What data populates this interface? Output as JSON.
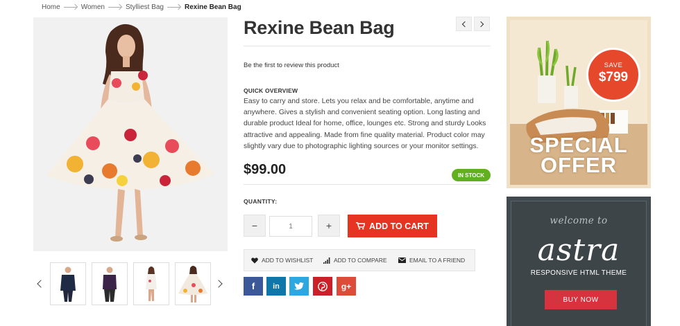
{
  "breadcrumb": {
    "items": [
      "Home",
      "Women",
      "Stylliest Bag"
    ],
    "current": "Rexine Bean Bag"
  },
  "product": {
    "title": "Rexine Bean Bag",
    "review_link": "Be the first to review this product",
    "overview_heading": "QUICK OVERVIEW",
    "overview_text": "Easy to carry and store. Lets you relax and be comfortable, anytime and anywhere. Gives a stylish and convenient seating option. Long lasting and durable product Ideal for home, office, lounges etc. Strong and sturdy Looks attractive and appealing. Made from fine quality material. Product color may slightly vary due to photographic lighting sources or your monitor settings.",
    "price": "$99.00",
    "stock_badge": "IN STOCK",
    "quantity_label": "QUANTITY:",
    "quantity_value": "1",
    "quantity_minus": "−",
    "quantity_plus": "+",
    "add_to_cart": "ADD TO CART"
  },
  "actions": {
    "wishlist": "ADD TO WISHLIST",
    "compare": "ADD TO COMPARE",
    "email": "EMAIL TO A FRIEND"
  },
  "social": [
    {
      "name": "facebook",
      "glyph": "f",
      "color": "#3b5998"
    },
    {
      "name": "linkedin",
      "glyph": "in",
      "color": "#0e76a8"
    },
    {
      "name": "twitter",
      "glyph": "t",
      "color": "#2da7e0"
    },
    {
      "name": "pinterest",
      "glyph": "P",
      "color": "#cb2027"
    },
    {
      "name": "google-plus",
      "glyph": "g+",
      "color": "#dd4b39"
    }
  ],
  "banner_offer": {
    "save_label": "SAVE",
    "save_amount": "$799",
    "line1": "SPECIAL",
    "line2": "OFFER"
  },
  "banner_astra": {
    "welcome": "welcome to",
    "brand": "astra",
    "tagline": "RESPONSIVE HTML THEME",
    "button": "BUY NOW"
  },
  "colors": {
    "accent_red": "#e63322",
    "stock_green": "#62b020",
    "astra_bg": "#414a4f",
    "buy_now": "#d6333e"
  }
}
